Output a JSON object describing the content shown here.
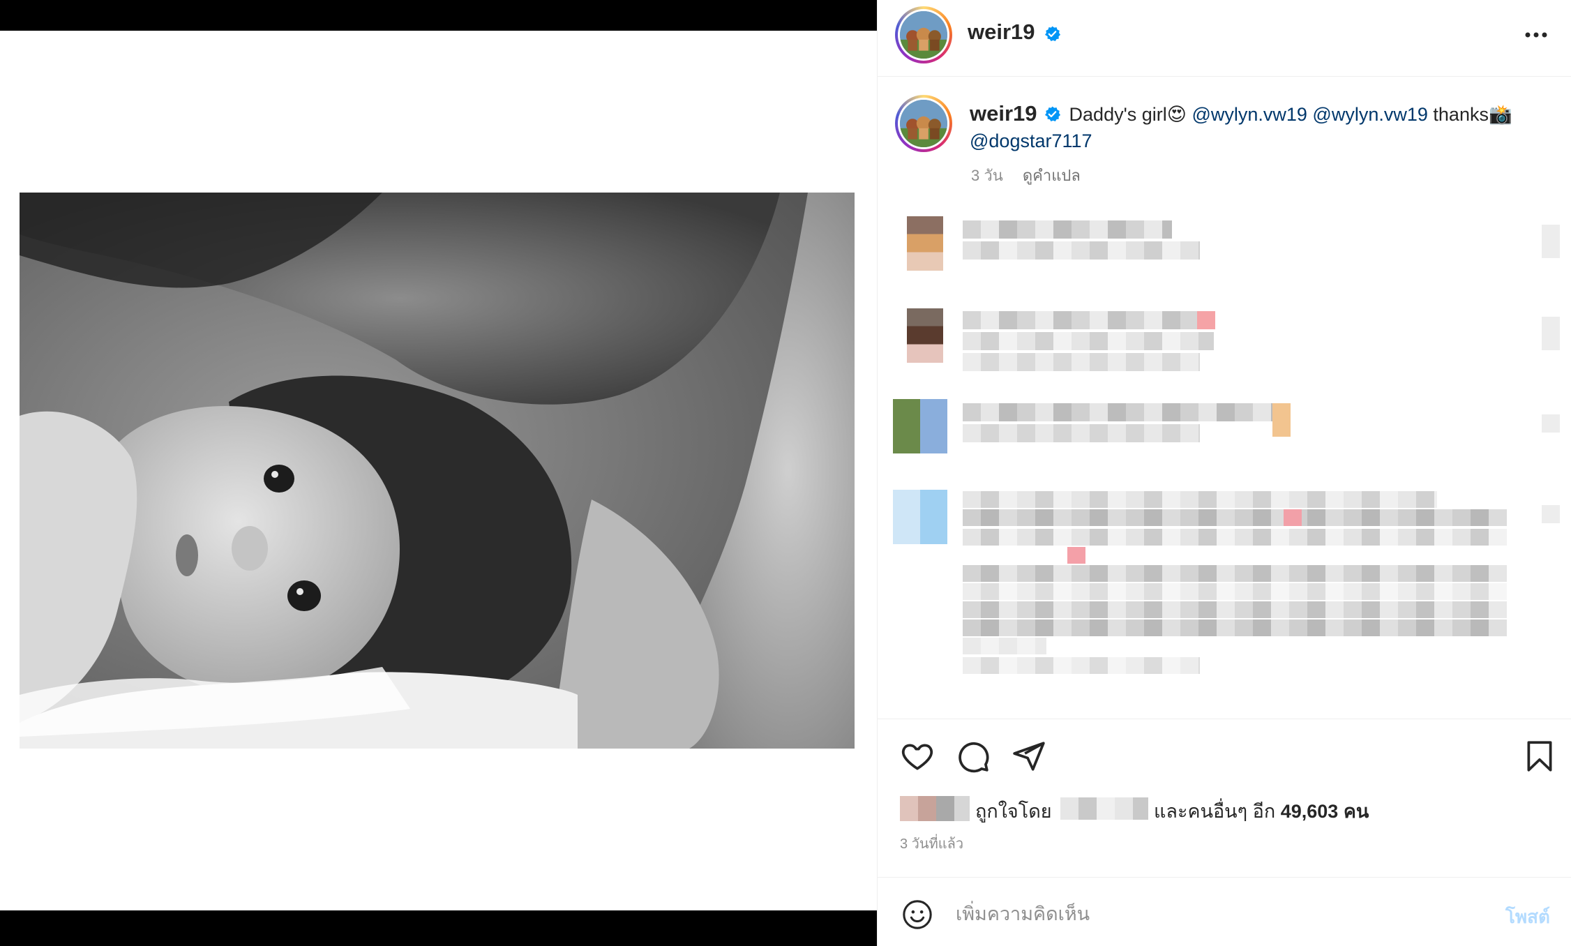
{
  "post": {
    "username": "weir19",
    "verified": true,
    "caption": {
      "text_before": "Daddy's girl",
      "emoji_1": "😍",
      "mention_1": "@wylyn.vw19",
      "mention_2": "@wylyn.vw19",
      "thanks": "thanks",
      "emoji_2": "📸",
      "mention_3": "@dogstar7117"
    },
    "caption_time": "3 วัน",
    "translate_label": "ดูคำแปล"
  },
  "likes": {
    "prefix": "ถูกใจโดย",
    "and_others": "และคนอื่นๆ อีก",
    "count": "49,603",
    "suffix": "คน"
  },
  "time_ago": "3 วันที่แล้ว",
  "comment": {
    "placeholder": "เพิ่มความคิดเห็น",
    "post_label": "โพสต์"
  },
  "icons": {
    "more": "more-horizontal-icon",
    "like": "heart-icon",
    "comment": "comment-bubble-icon",
    "share": "paper-plane-icon",
    "save": "bookmark-icon",
    "emoji": "smiley-icon",
    "verified": "verified-badge-icon"
  },
  "colors": {
    "mention": "#00376b",
    "verified": "#0095f6",
    "post_button_disabled": "#b3dbff",
    "muted_text": "#8e8e8e"
  }
}
